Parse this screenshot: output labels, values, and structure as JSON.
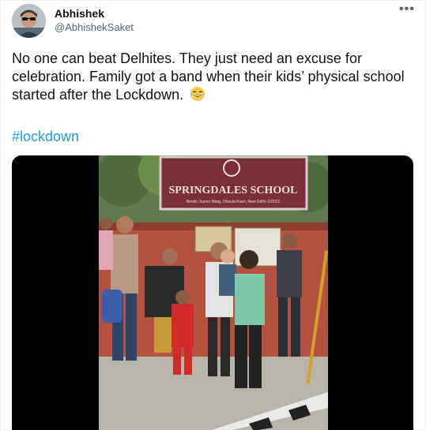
{
  "author": {
    "display_name": "Abhishek",
    "handle": "@AbhishekSaket",
    "avatar_icon": "user-avatar"
  },
  "more_icon": "more-horizontal-icon",
  "tweet": {
    "text": "No one can beat Delhites. They just need an excuse for celebration. Family got a band when their kids’ physical school started after the Lockdown.",
    "emoji": "face-with-tears-of-joy",
    "hashtag": "#lockdown"
  },
  "media": {
    "school_sign_title": "SPRINGDALES SCHOOL",
    "school_sign_subtitle": "Benito Juarez Marg, Dhaula Kuan, New Delhi-110021"
  },
  "colors": {
    "link": "#1d9bf0",
    "secondary_text": "#536471",
    "primary_text": "#0f1419"
  }
}
